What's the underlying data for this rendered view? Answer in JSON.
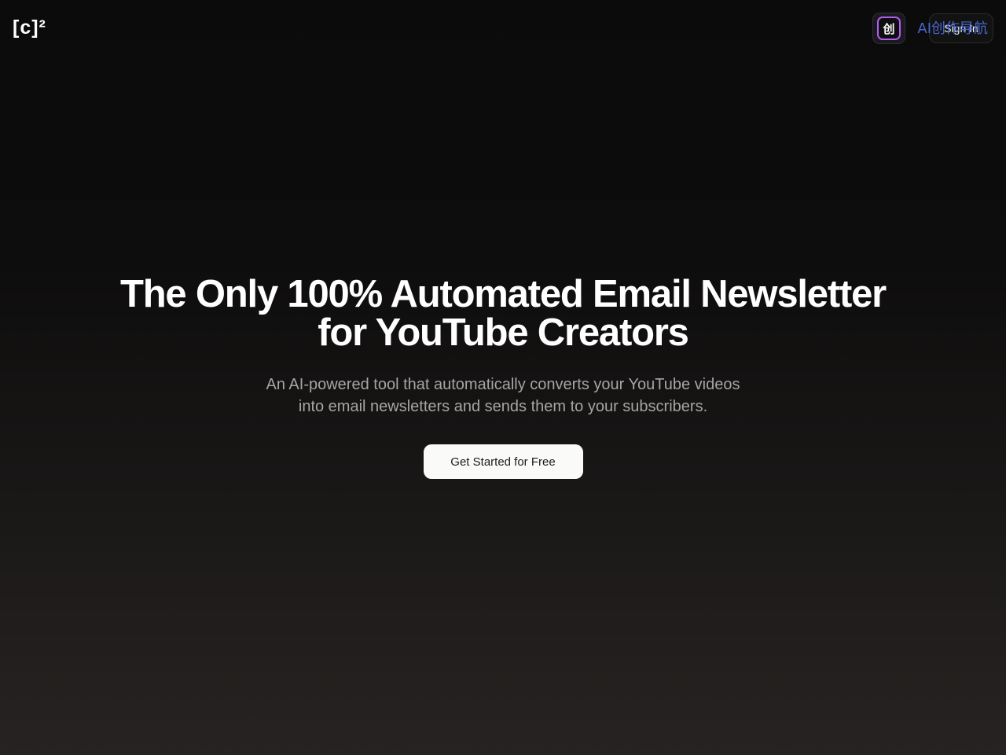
{
  "header": {
    "logo": "[c]²",
    "extension_icon_glyph": "创",
    "extension_label": "AI创作导航",
    "sign_in_label": "Sign In"
  },
  "hero": {
    "title_line1": "The Only 100% Automated Email Newsletter",
    "title_line2": "for YouTube Creators",
    "subtitle_line1": "An AI-powered tool that automatically converts your YouTube videos",
    "subtitle_line2": "into email newsletters and sends them to your subscribers.",
    "cta_label": "Get Started for Free"
  },
  "colors": {
    "background_top": "#0b0b0b",
    "background_bottom": "#272322",
    "cta_background": "#fafaf9",
    "subtitle_text": "#a8a4a3",
    "extension_accent": "#b05cf0"
  }
}
